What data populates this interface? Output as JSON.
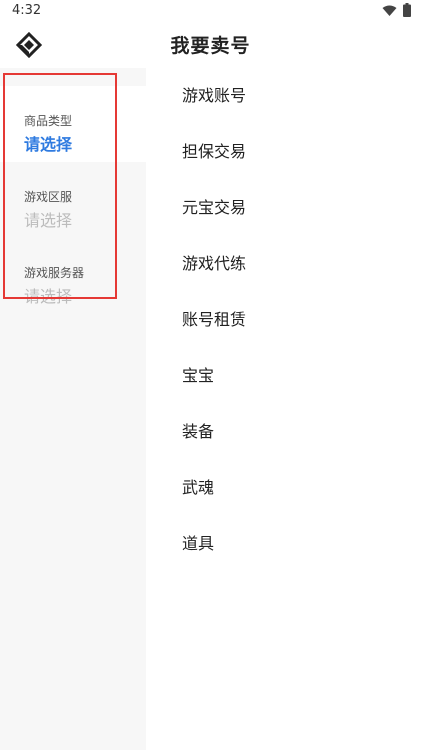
{
  "status_bar": {
    "time": "4:32",
    "icons": [
      "wifi-icon",
      "battery-icon"
    ]
  },
  "header": {
    "title": "我要卖号",
    "logo_icon": "diamond-logo-icon"
  },
  "filters": [
    {
      "label": "商品类型",
      "value": "请选择",
      "active": true
    },
    {
      "label": "游戏区服",
      "value": "请选择",
      "active": false
    },
    {
      "label": "游戏服务器",
      "value": "请选择",
      "active": false
    }
  ],
  "options": [
    "游戏账号",
    "担保交易",
    "元宝交易",
    "游戏代练",
    "账号租赁",
    "宝宝",
    "装备",
    "武魂",
    "道具"
  ],
  "colors": {
    "accent": "#2f7be0",
    "highlight_border": "#e53935",
    "left_panel_bg": "#f7f7f7",
    "placeholder": "#bcbcbc"
  }
}
